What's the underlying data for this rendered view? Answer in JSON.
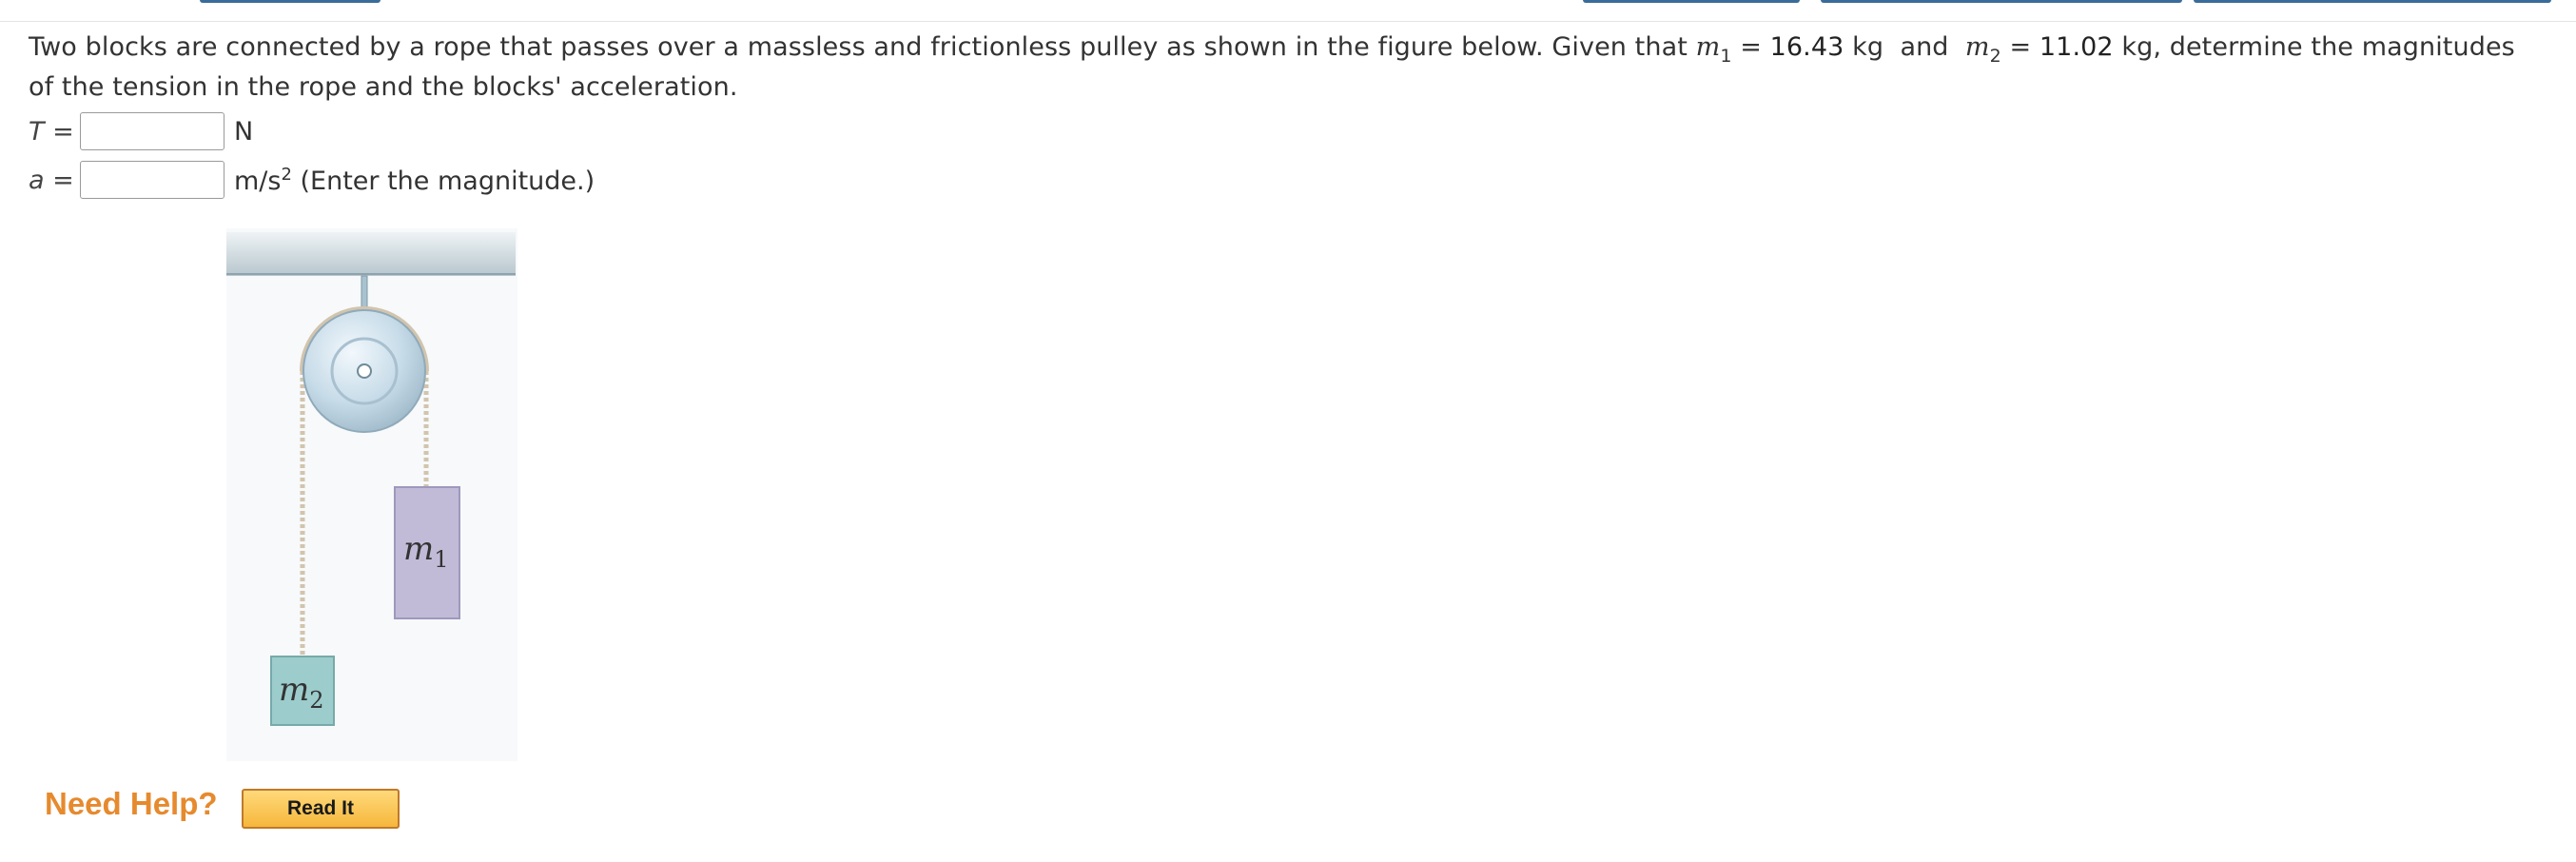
{
  "problem": {
    "text_a": "Two blocks are connected by a rope that passes over a massless and frictionless pulley as shown in the figure below. Given that ",
    "m1_symbol": "m",
    "m1_sub": "1",
    "equals": " = ",
    "m1_value": "16.43",
    "kg1": " kg",
    "and": "  and  ",
    "m2_symbol": "m",
    "m2_sub": "2",
    "m2_value": "11.02",
    "kg2": " kg,",
    "text_b": "  determine the magnitudes of the tension in the rope and the blocks' acceleration."
  },
  "answers": [
    {
      "label": "T =",
      "unit": "N",
      "unit_sup": "",
      "note": "",
      "value": ""
    },
    {
      "label": "a =",
      "unit": "m/s",
      "unit_sup": "2",
      "note": " (Enter the magnitude.)",
      "value": ""
    }
  ],
  "figure": {
    "block1_label": "m",
    "block1_sub": "1",
    "block2_label": "m",
    "block2_sub": "2",
    "colors": {
      "ceiling": "#d3dde1",
      "pulley": "#c9dde9",
      "rope": "#d7c9b5",
      "block1": "#c1bbd7",
      "block2": "#9ccccc"
    }
  },
  "help": {
    "title": "Need Help?",
    "read_it_label": "Read It"
  }
}
